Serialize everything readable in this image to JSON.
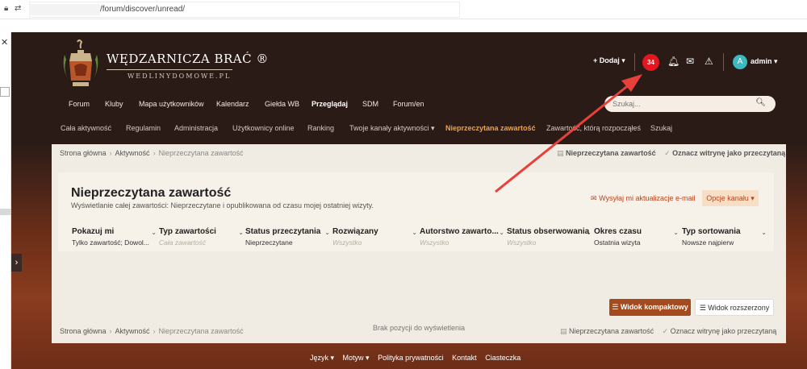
{
  "browser": {
    "url_suffix": "/forum/discover/unread/",
    "lock_icon": "lock-icon",
    "swap_icon": "swap-icon"
  },
  "site": {
    "logo_title": "WĘDZARNICZA BRAĆ ®",
    "logo_sub": "WEDLINYDOMOWE.PL",
    "add_label": "+ Dodaj ▾",
    "notif_count": "34",
    "user_initial": "A",
    "user_name": "admin ▾",
    "accent": "#e4161f"
  },
  "main_nav": [
    "Forum",
    "Kluby",
    "Mapa użytkowników",
    "Kalendarz",
    "Giełda WB",
    "Przeglądaj",
    "SDM",
    "Forum/en"
  ],
  "main_nav_active": "Przeglądaj",
  "search": {
    "placeholder": "Szukaj..."
  },
  "sub_nav": [
    "Cała aktywność",
    "Regulamin",
    "Administracja",
    "Użytkownicy online",
    "Ranking",
    "Twoje kanały aktywności ▾",
    "Nieprzeczytana zawartość",
    "Zawartość, którą rozpocząłeś",
    "Szukaj"
  ],
  "breadcrumbs": {
    "home": "Strona główna",
    "activity": "Aktywność",
    "current": "Nieprzeczytana zawartość"
  },
  "crumb_actions": {
    "unread": "Nieprzeczytana zawartość",
    "mark_read": "Oznacz witrynę jako przeczytaną"
  },
  "page": {
    "title": "Nieprzeczytana zawartość",
    "desc": "Wyświetlanie całej zawartości: Nieprzeczytane i opublikowana od czasu mojej ostatniej wizyty.",
    "notify": "Wysyłaj mi aktualizacje e-mail",
    "feed_opts": "Opcje kanału ▾"
  },
  "filters": [
    {
      "label": "Pokazuj mi",
      "value": "Tylko zawartość; Dowol...",
      "muted": false
    },
    {
      "label": "Typ zawartości",
      "value": "Cała zawartość",
      "muted": true
    },
    {
      "label": "Status przeczytania",
      "value": "Nieprzeczytane",
      "muted": false
    },
    {
      "label": "Rozwiązany",
      "value": "Wszystko",
      "muted": true
    },
    {
      "label": "Autorstwo zawarto...",
      "value": "Wszystko",
      "muted": true
    },
    {
      "label": "Status obserwowania",
      "value": "Wszystko",
      "muted": true
    },
    {
      "label": "Okres czasu",
      "value": "Ostatnia wizyta",
      "muted": false
    },
    {
      "label": "Typ sortowania",
      "value": "Nowsze najpierw",
      "muted": false
    }
  ],
  "views": {
    "compact": "Widok kompaktowy",
    "expanded": "Widok rozszerzony"
  },
  "empty": "Brak pozycji do wyświetlenia",
  "footer": [
    "Język ▾",
    "Motyw ▾",
    "Polityka prywatności",
    "Kontakt",
    "Ciasteczka"
  ]
}
